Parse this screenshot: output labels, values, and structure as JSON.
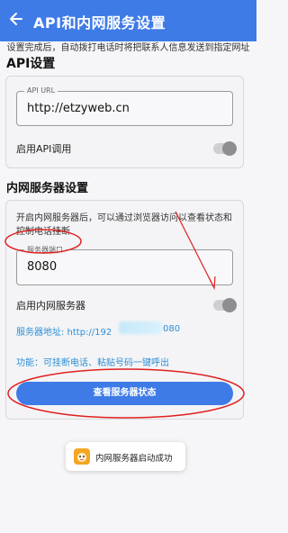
{
  "header": {
    "title": "API和内网服务设置",
    "background": "#3f7be6"
  },
  "description": "设置完成后，自动拨打电话时将把联系人信息发送到指定网址",
  "api_section": {
    "heading": "API设置",
    "url_field": {
      "label": "API URL",
      "value": "http://etzyweb.cn"
    },
    "enable_label": "启用API调用",
    "enabled": false
  },
  "intranet_section": {
    "heading": "内网服务器设置",
    "info": "开启内网服务器后，可以通过浏览器访问以查看状态和控制电话挂断",
    "port_field": {
      "label": "服务器端口",
      "value": "8080"
    },
    "enable_label": "启用内网服务器",
    "enabled": false,
    "server_address": "服务器地址: http://192",
    "server_address_tail": "080",
    "features": "功能：可挂断电话、粘贴号码一键呼出",
    "status_button": "查看服务器状态"
  },
  "toast": {
    "text": "内网服务器启动成功"
  },
  "colors": {
    "accent": "#3f7be6",
    "link": "#2d8fd6",
    "annotation": "#e02020"
  }
}
